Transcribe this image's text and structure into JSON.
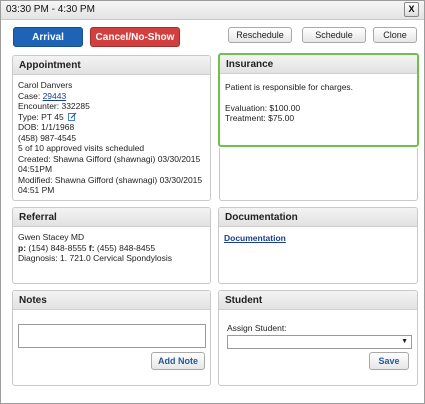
{
  "window": {
    "title": "03:30 PM - 4:30 PM",
    "close_label": "X"
  },
  "toolbar": {
    "arrival": "Arrival",
    "cancel": "Cancel/No-Show",
    "reschedule": "Reschedule",
    "schedule": "Schedule",
    "clone": "Clone"
  },
  "appointment": {
    "heading": "Appointment",
    "patient": "Carol Danvers",
    "case_label": "Case: ",
    "case_number": "29443",
    "encounter": "Encounter: 332285",
    "type": "Type: PT 45",
    "dob": "DOB: 1/1/1968",
    "phone": "(458) 987-4545",
    "visits": "5 of 10 approved visits scheduled",
    "created": "Created: Shawna Gifford (shawnagi) 03/30/2015 04:51PM",
    "modified": "Modified: Shawna Gifford (shawnagi) 03/30/2015 04:51 PM"
  },
  "insurance": {
    "heading": "Insurance",
    "note": "Patient is responsible for charges.",
    "evaluation": "Evaluation: $100.00",
    "treatment": "Treatment: $75.00"
  },
  "referral": {
    "heading": "Referral",
    "doctor": "Gwen Stacey MD",
    "phone_label": "p:",
    "phone": " (154) 848-8555 ",
    "fax_label": "f:",
    "fax": " (455) 848-8455",
    "diagnosis": "Diagnosis:  1. 721.0 Cervical Spondylosis"
  },
  "documentation": {
    "heading": "Documentation",
    "link": "Documentation"
  },
  "notes": {
    "heading": "Notes",
    "input_value": "",
    "add_button": "Add Note"
  },
  "student": {
    "heading": "Student",
    "assign_label": "Assign Student:",
    "selected": "",
    "save_button": "Save"
  },
  "colors": {
    "arrival": "#1f63b6",
    "cancel": "#d23f3f",
    "insurance_border": "#6cc24a",
    "link": "#1a3f8f"
  }
}
